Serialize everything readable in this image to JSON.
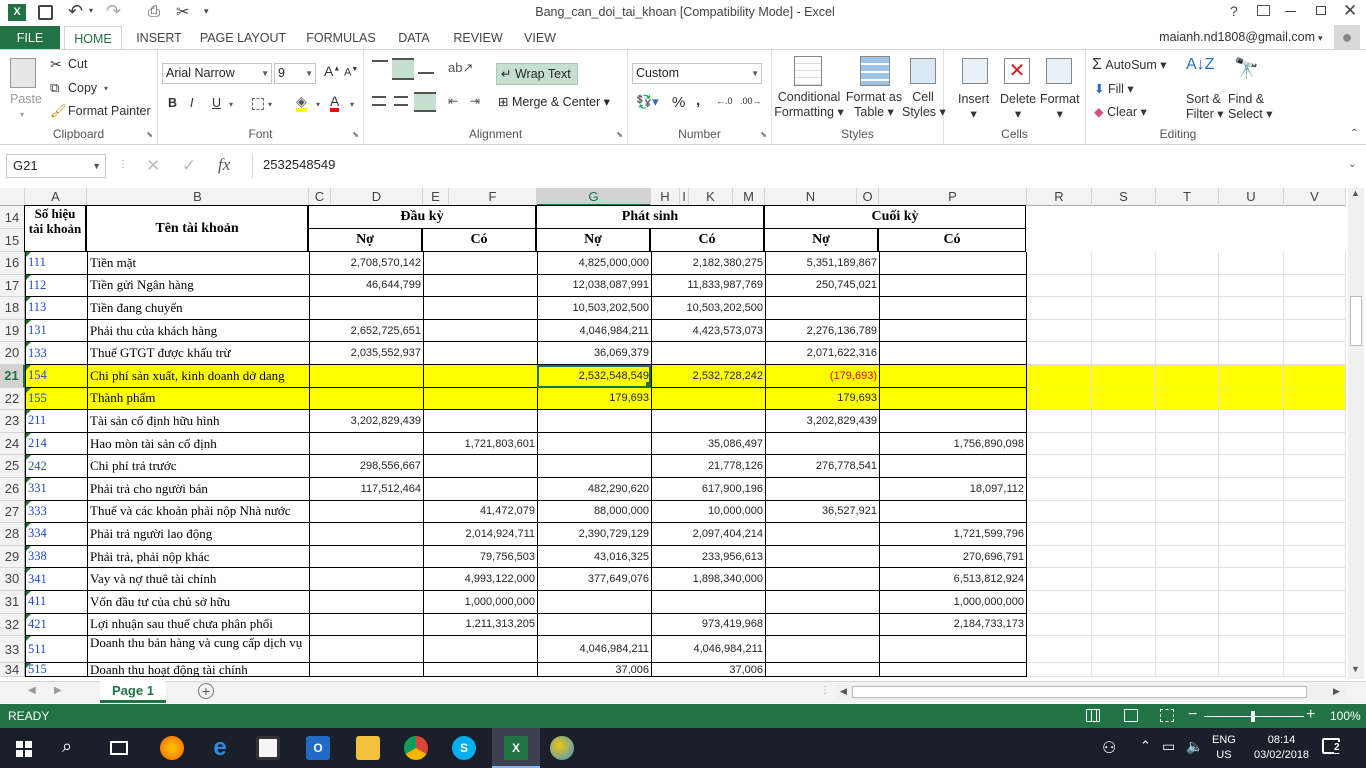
{
  "window": {
    "title": "Bang_can_doi_tai_khoan  [Compatibility Mode] - Excel",
    "user": "maianh.nd1808@gmail.com",
    "help": "?"
  },
  "tabs": [
    "FILE",
    "HOME",
    "INSERT",
    "PAGE LAYOUT",
    "FORMULAS",
    "DATA",
    "REVIEW",
    "VIEW"
  ],
  "ribbon": {
    "clipboard": {
      "label": "Clipboard",
      "paste": "Paste",
      "cut": "Cut",
      "copy": "Copy",
      "format_painter": "Format Painter"
    },
    "font": {
      "label": "Font",
      "name": "Arial Narrow",
      "size": "9",
      "bold": "B",
      "italic": "I",
      "underline": "U"
    },
    "alignment": {
      "label": "Alignment",
      "wrap": "Wrap Text",
      "merge": "Merge & Center"
    },
    "number": {
      "label": "Number",
      "format": "Custom",
      "percent": "%",
      "comma": ","
    },
    "styles": {
      "label": "Styles",
      "conditional1": "Conditional",
      "conditional2": "Formatting",
      "format_as1": "Format as",
      "format_as2": "Table",
      "cell1": "Cell",
      "cell2": "Styles"
    },
    "cells": {
      "label": "Cells",
      "insert": "Insert",
      "delete": "Delete",
      "format": "Format"
    },
    "editing": {
      "label": "Editing",
      "autosum": "AutoSum",
      "fill": "Fill",
      "clear": "Clear",
      "sort1": "Sort &",
      "sort2": "Filter",
      "find1": "Find &",
      "find2": "Select"
    }
  },
  "formula": {
    "name_box": "G21",
    "fx": "fx",
    "value": "2532548549"
  },
  "columns": [
    "A",
    "B",
    "C",
    "D",
    "E",
    "F",
    "G",
    "H",
    "I",
    "K",
    "M",
    "N",
    "O",
    "P",
    "R",
    "S",
    "T",
    "U",
    "V"
  ],
  "header": {
    "code": "Số hiệu tài khoản",
    "name": "Tên tài khoản",
    "open": "Đầu kỳ",
    "period": "Phát sinh",
    "close": "Cuối kỳ",
    "debit": "Nợ",
    "credit": "Có"
  },
  "rows": [
    {
      "r": "16",
      "code": "111",
      "name": "Tiền mặt",
      "d1": "2,708,570,142",
      "c1": "",
      "d2": "4,825,000,000",
      "c2": "2,182,380,275",
      "d3": "5,351,189,867",
      "c3": ""
    },
    {
      "r": "17",
      "code": "112",
      "name": "Tiền gửi Ngân hàng",
      "d1": "46,644,799",
      "c1": "",
      "d2": "12,038,087,991",
      "c2": "11,833,987,769",
      "d3": "250,745,021",
      "c3": ""
    },
    {
      "r": "18",
      "code": "113",
      "name": "Tiền đang chuyển",
      "d1": "",
      "c1": "",
      "d2": "10,503,202,500",
      "c2": "10,503,202,500",
      "d3": "",
      "c3": ""
    },
    {
      "r": "19",
      "code": "131",
      "name": "Phải thu của khách hàng",
      "d1": "2,652,725,651",
      "c1": "",
      "d2": "4,046,984,211",
      "c2": "4,423,573,073",
      "d3": "2,276,136,789",
      "c3": ""
    },
    {
      "r": "20",
      "code": "133",
      "name": "Thuế GTGT được khấu trừ",
      "d1": "2,035,552,937",
      "c1": "",
      "d2": "36,069,379",
      "c2": "",
      "d3": "2,071,622,316",
      "c3": ""
    },
    {
      "r": "21",
      "code": "154",
      "name": "Chi phí sản xuất, kinh doanh dở dang",
      "d1": "",
      "c1": "",
      "d2": "2,532,548,549",
      "c2": "2,532,728,242",
      "d3": "(179,693)",
      "c3": "",
      "hl": true,
      "neg": true
    },
    {
      "r": "22",
      "code": "155",
      "name": "Thành phẩm",
      "d1": "",
      "c1": "",
      "d2": "179,693",
      "c2": "",
      "d3": "179,693",
      "c3": "",
      "hl": true
    },
    {
      "r": "23",
      "code": "211",
      "name": "Tài sản cố định hữu hình",
      "d1": "3,202,829,439",
      "c1": "",
      "d2": "",
      "c2": "",
      "d3": "3,202,829,439",
      "c3": ""
    },
    {
      "r": "24",
      "code": "214",
      "name": "Hao mòn tài sản cố định",
      "d1": "",
      "c1": "1,721,803,601",
      "d2": "",
      "c2": "35,086,497",
      "d3": "",
      "c3": "1,756,890,098"
    },
    {
      "r": "25",
      "code": "242",
      "name": "Chi phí trả trước",
      "d1": "298,556,667",
      "c1": "",
      "d2": "",
      "c2": "21,778,126",
      "d3": "276,778,541",
      "c3": ""
    },
    {
      "r": "26",
      "code": "331",
      "name": "Phải trả cho người bán",
      "d1": "117,512,464",
      "c1": "",
      "d2": "482,290,620",
      "c2": "617,900,196",
      "d3": "",
      "c3": "18,097,112"
    },
    {
      "r": "27",
      "code": "333",
      "name": "Thuế và các khoản phải nộp Nhà nước",
      "d1": "",
      "c1": "41,472,079",
      "d2": "88,000,000",
      "c2": "10,000,000",
      "d3": "36,527,921",
      "c3": ""
    },
    {
      "r": "28",
      "code": "334",
      "name": "Phải trả người lao động",
      "d1": "",
      "c1": "2,014,924,711",
      "d2": "2,390,729,129",
      "c2": "2,097,404,214",
      "d3": "",
      "c3": "1,721,599,796"
    },
    {
      "r": "29",
      "code": "338",
      "name": "Phải trả, phải nộp khác",
      "d1": "",
      "c1": "79,756,503",
      "d2": "43,016,325",
      "c2": "233,956,613",
      "d3": "",
      "c3": "270,696,791"
    },
    {
      "r": "30",
      "code": "341",
      "name": "Vay và nợ thuê tài chính",
      "d1": "",
      "c1": "4,993,122,000",
      "d2": "377,649,076",
      "c2": "1,898,340,000",
      "d3": "",
      "c3": "6,513,812,924"
    },
    {
      "r": "31",
      "code": "411",
      "name": "Vốn đầu tư của chủ sở hữu",
      "d1": "",
      "c1": "1,000,000,000",
      "d2": "",
      "c2": "",
      "d3": "",
      "c3": "1,000,000,000"
    },
    {
      "r": "32",
      "code": "421",
      "name": "Lợi nhuận sau thuế chưa phân phối",
      "d1": "",
      "c1": "1,211,313,205",
      "d2": "",
      "c2": "973,419,968",
      "d3": "",
      "c3": "2,184,733,173"
    },
    {
      "r": "33",
      "code": "511",
      "name": "Doanh thu bán hàng và cung cấp dịch vụ",
      "d1": "",
      "c1": "",
      "d2": "4,046,984,211",
      "c2": "4,046,984,211",
      "d3": "",
      "c3": ""
    },
    {
      "r": "34",
      "code": "515",
      "name": "Doanh thu hoạt động tài chính",
      "d1": "",
      "c1": "",
      "d2": "37,006",
      "c2": "37,006",
      "d3": "",
      "c3": ""
    }
  ],
  "sheet": {
    "tab": "Page 1"
  },
  "status": {
    "ready": "READY",
    "zoom": "100%"
  },
  "taskbar": {
    "lang1": "ENG",
    "lang2": "US",
    "time": "08:14",
    "date": "03/02/2018",
    "notif": "2"
  }
}
